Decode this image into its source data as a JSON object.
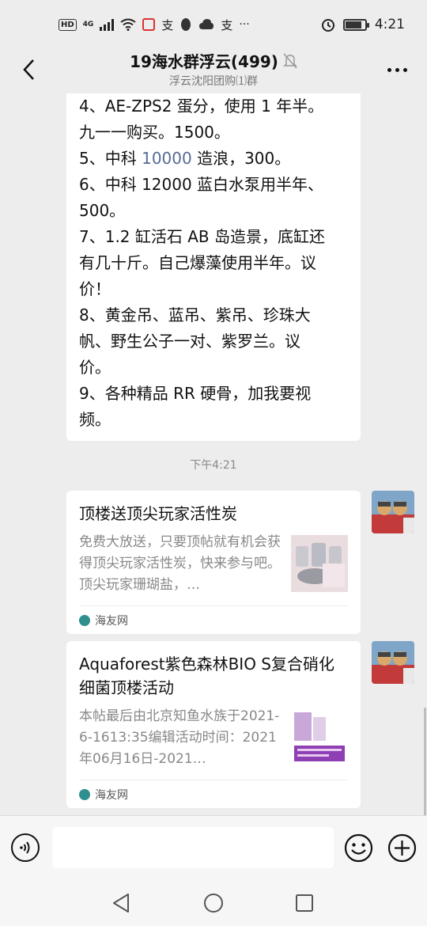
{
  "status_bar": {
    "hd": "HD",
    "network": "4G",
    "wechat_icon_text": "支",
    "qq_icon": "qq-penguin-icon",
    "ellipsis": "···",
    "time": "4:21"
  },
  "header": {
    "title": "19海水群浮云(499)",
    "subtitle": "浮云沈阳团购⑴群",
    "back_icon": "chevron-left-icon",
    "mute_icon": "bell-off-icon",
    "more_icon": "more-dots-icon"
  },
  "message": {
    "lines": [
      "4、AE-ZPS2 蛋分，使用 1 年半。",
      "九一一购买。1500。",
      "5、中科 ",
      "6、中科 12000 蓝白水泵用半年、",
      "500。",
      "7、1.2 缸活石 AB 岛造景，底缸还",
      "有几十斤。自己爆藻使用半年。议",
      "价！",
      "8、黄金吊、蓝吊、紫吊、珍珠大",
      "帆、野生公子一对、紫罗兰。议",
      "价。",
      "9、各种精品 RR 硬骨，加我要视",
      "频。"
    ],
    "link_text": "10000",
    "line5_suffix": " 造浪，300。"
  },
  "timestamp": "下午4:21",
  "cards": [
    {
      "title": "顶楼送顶尖玩家活性炭",
      "desc": "免费大放送，只要顶帖就有机会获得顶尖玩家活性炭，快来参与吧。顶尖玩家珊瑚盐，…",
      "source": "海友网"
    },
    {
      "title": "Aquaforest紫色森林BIO S复合硝化细菌顶楼活动",
      "desc": "本帖最后由北京知鱼水族于2021-6-1613:35编辑活动时间：2021年06月16日-2021…",
      "source": "海友网"
    }
  ],
  "input_bar": {
    "voice_icon": "voice-icon",
    "emoji_icon": "emoji-icon",
    "plus_icon": "plus-icon"
  },
  "nav_bar": {
    "back_icon": "triangle-back-icon",
    "home_icon": "circle-home-icon",
    "recent_icon": "square-recent-icon"
  },
  "colors": {
    "background": "#ededed",
    "link": "#576b95",
    "bubble": "#ffffff"
  }
}
